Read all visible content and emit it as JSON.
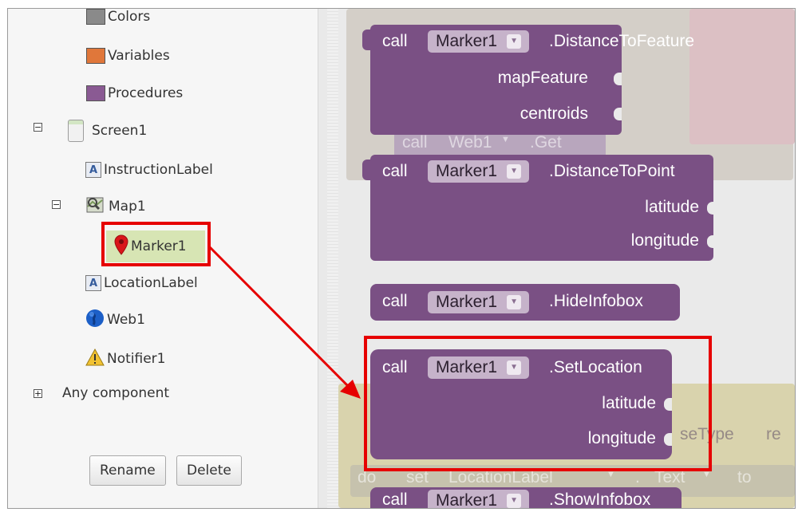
{
  "tree": {
    "items": [
      {
        "label": "Colors",
        "icon": "colors-swatch-icon",
        "color": "#8a8a8a"
      },
      {
        "label": "Variables",
        "icon": "variables-swatch-icon",
        "color": "#e0773a"
      },
      {
        "label": "Procedures",
        "icon": "procedures-swatch-icon",
        "color": "#8a5a93"
      },
      {
        "label": "Screen1",
        "icon": "screen-icon"
      },
      {
        "label": "InstructionLabel",
        "icon": "label-icon"
      },
      {
        "label": "Map1",
        "icon": "map-icon"
      },
      {
        "label": "Marker1",
        "icon": "marker-pin-icon",
        "selected": true
      },
      {
        "label": "LocationLabel",
        "icon": "label-icon"
      },
      {
        "label": "Web1",
        "icon": "globe-icon"
      },
      {
        "label": "Notifier1",
        "icon": "warning-triangle-icon"
      },
      {
        "label": "Any component",
        "icon": "expand-plus-icon"
      }
    ],
    "label_icon_glyph": "A",
    "collapse_glyph": "−",
    "expand_glyph": "+",
    "rename_label": "Rename",
    "delete_label": "Delete"
  },
  "blocks": {
    "call_word": "call",
    "component": "Marker1",
    "dropdown_glyph": "▼",
    "distance_to_feature": {
      "method": ".DistanceToFeature",
      "params": [
        "mapFeature",
        "centroids"
      ]
    },
    "distance_to_point": {
      "method": ".DistanceToPoint",
      "params": [
        "latitude",
        "longitude"
      ]
    },
    "hide_infobox": {
      "method": ".HideInfobox"
    },
    "set_location": {
      "method": ".SetLocation",
      "params": [
        "latitude",
        "longitude"
      ]
    },
    "show_infobox": {
      "method": ".ShowInfobox"
    }
  },
  "background_blocks": {
    "web_get": {
      "call": "call",
      "component": "Web1",
      "arrow": "▼",
      "method": ".Get"
    },
    "set_line": {
      "do": "do",
      "set": "set",
      "component": "LocationLabel",
      "arrow": "▼",
      "dot": ".",
      "property": "Text",
      "arrow2": "▼",
      "to": "to"
    },
    "partial_type": "seType",
    "partial_re": "re"
  },
  "colors": {
    "procedure_block": "#7a5084",
    "highlight": "#e60000",
    "selected_item": "#d7e5b4"
  }
}
